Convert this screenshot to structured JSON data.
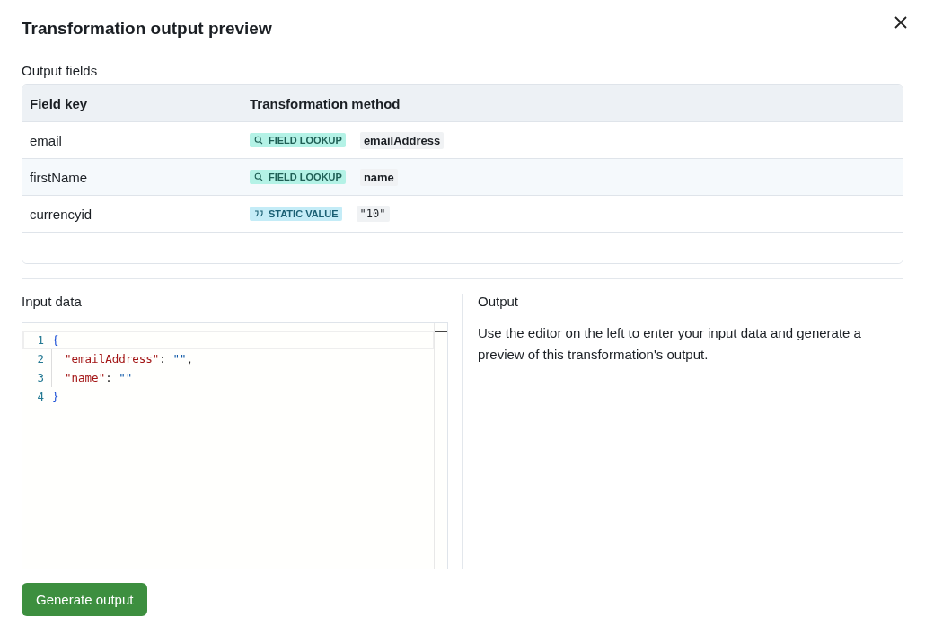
{
  "dialog": {
    "title": "Transformation output preview"
  },
  "output_fields": {
    "label": "Output fields",
    "columns": [
      "Field key",
      "Transformation method"
    ],
    "rows": [
      {
        "key": "email",
        "method": {
          "kind": "lookup",
          "label": "FIELD LOOKUP"
        },
        "value": "emailAddress"
      },
      {
        "key": "firstName",
        "method": {
          "kind": "lookup",
          "label": "FIELD LOOKUP"
        },
        "value": "name"
      },
      {
        "key": "currencyid",
        "method": {
          "kind": "static",
          "label": "STATIC VALUE"
        },
        "value": "\"10\""
      }
    ]
  },
  "input": {
    "label": "Input data",
    "lines": [
      {
        "number": "1",
        "indent": false,
        "tokens": [
          {
            "kind": "brace",
            "text": "{"
          }
        ]
      },
      {
        "number": "2",
        "indent": true,
        "tokens": [
          {
            "kind": "key",
            "text": "\"emailAddress\""
          },
          {
            "kind": "punct",
            "text": ": "
          },
          {
            "kind": "string",
            "text": "\"\""
          },
          {
            "kind": "punct",
            "text": ","
          }
        ]
      },
      {
        "number": "3",
        "indent": true,
        "tokens": [
          {
            "kind": "key",
            "text": "\"name\""
          },
          {
            "kind": "punct",
            "text": ": "
          },
          {
            "kind": "string",
            "text": "\"\""
          }
        ]
      },
      {
        "number": "4",
        "indent": false,
        "tokens": [
          {
            "kind": "brace",
            "text": "}"
          }
        ]
      }
    ]
  },
  "output": {
    "label": "Output",
    "message": "Use the editor on the left to enter your input data and generate a preview of this transformation's output."
  },
  "generate_button": {
    "label": "Generate output"
  }
}
